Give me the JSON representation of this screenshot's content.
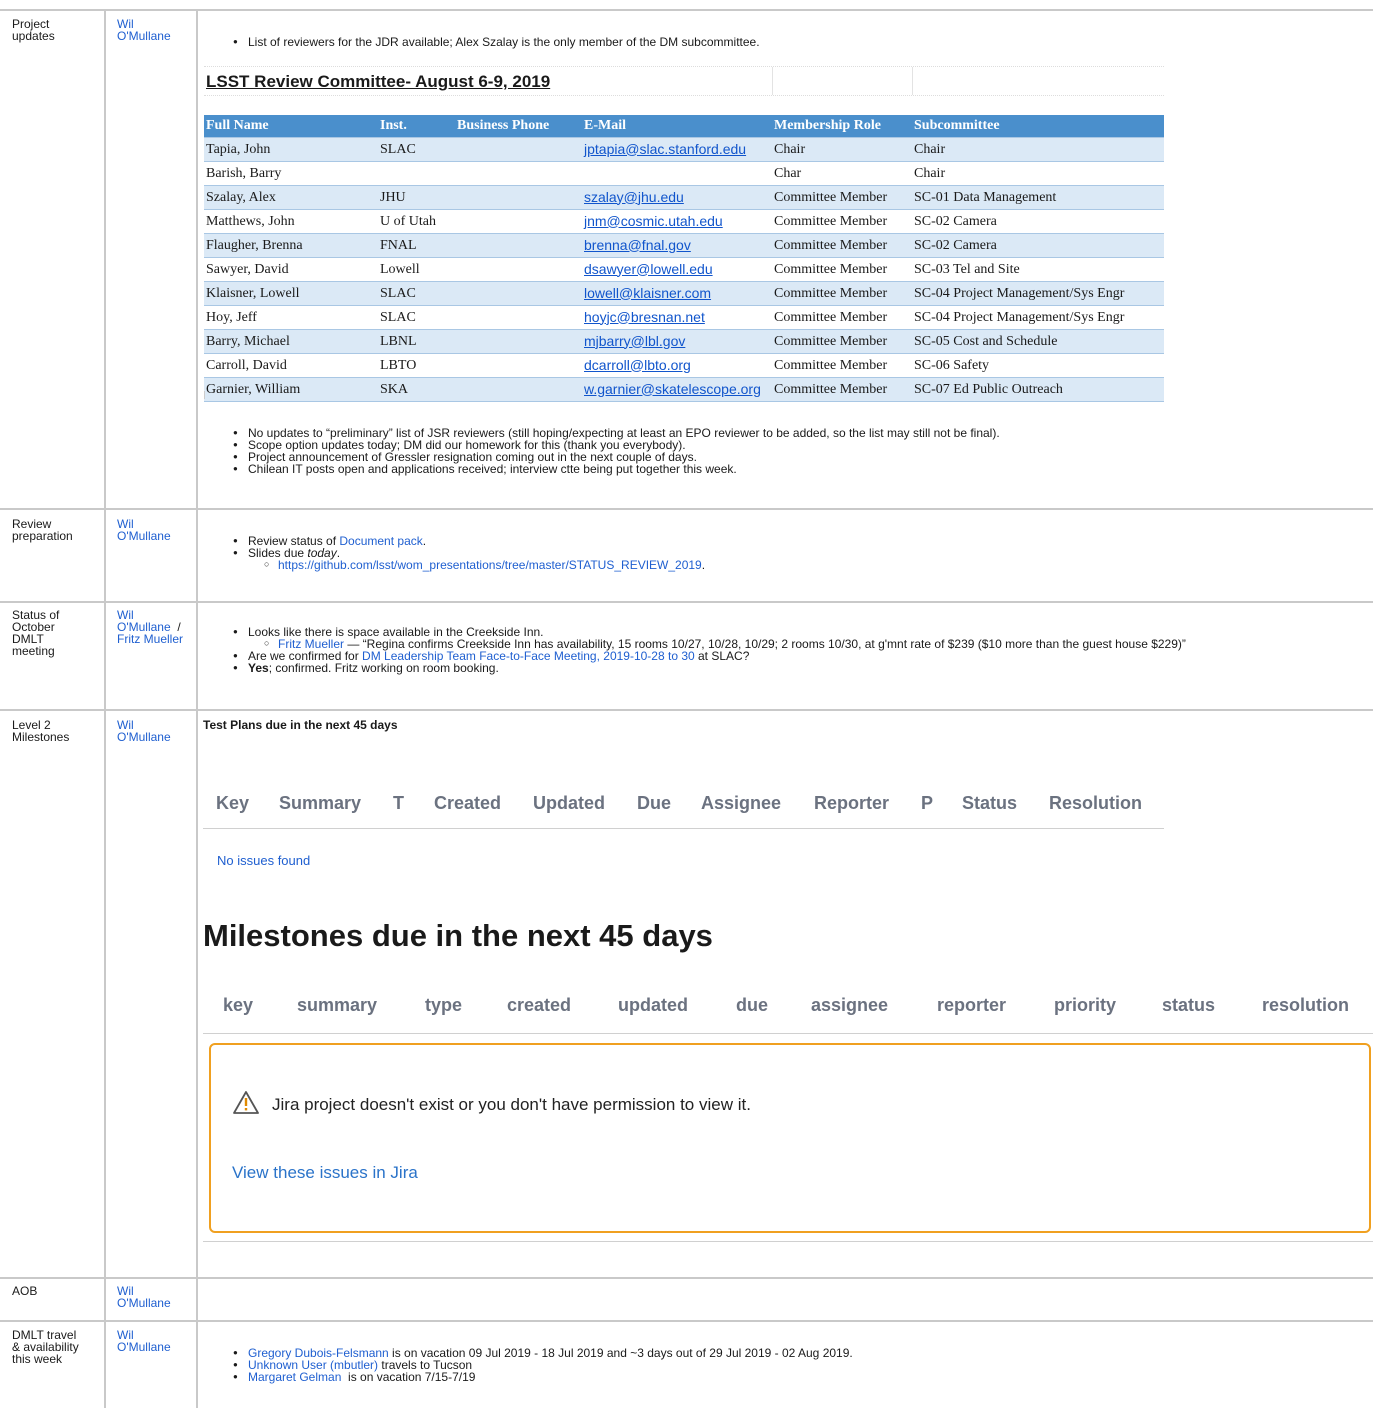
{
  "rows": [
    {
      "topic": [
        "Project",
        "updates"
      ],
      "owner": [
        "Wil",
        "O'Mullane"
      ]
    },
    {
      "topic": [
        "Review",
        "preparation"
      ],
      "owner": [
        "Wil",
        "O'Mullane"
      ]
    },
    {
      "topic": [
        "Status of",
        "October",
        "DMLT",
        "meeting"
      ],
      "owner": [
        "Wil",
        "O'Mullane",
        "/",
        "Fritz Mueller"
      ]
    },
    {
      "topic": [
        "Level 2",
        "Milestones"
      ],
      "owner": [
        "Wil",
        "O'Mullane"
      ]
    },
    {
      "topic": [
        "AOB"
      ],
      "owner": [
        "Wil",
        "O'Mullane"
      ]
    },
    {
      "topic": [
        "DMLT travel",
        "& availability",
        "this week"
      ],
      "owner": [
        "Wil",
        "O'Mullane"
      ]
    }
  ],
  "project": {
    "bullet1": "List of reviewers for the JDR available; Alex Szalay is the only member of the DM subcommittee.",
    "committee_title": "LSST Review Committee- August 6-9, 2019",
    "headers": [
      "Full Name",
      "Inst.",
      "Business Phone",
      "E-Mail",
      "Membership Role",
      "Subcommittee"
    ],
    "members": [
      [
        "Tapia, John",
        "SLAC",
        "",
        "jptapia@slac.stanford.edu",
        "Chair",
        "Chair"
      ],
      [
        "Barish, Barry",
        "",
        "",
        "",
        "Char",
        "Chair"
      ],
      [
        "Szalay, Alex",
        "JHU",
        "",
        "szalay@jhu.edu",
        "Committee Member",
        "SC-01 Data Management"
      ],
      [
        "Matthews, John",
        "U of Utah",
        "",
        "jnm@cosmic.utah.edu",
        "Committee Member",
        "SC-02 Camera"
      ],
      [
        "Flaugher, Brenna",
        "FNAL",
        "",
        "brenna@fnal.gov",
        "Committee Member",
        "SC-02 Camera"
      ],
      [
        "Sawyer, David",
        "Lowell",
        "",
        "dsawyer@lowell.edu",
        "Committee Member",
        "SC-03 Tel and Site"
      ],
      [
        "Klaisner, Lowell",
        "SLAC",
        "",
        "lowell@klaisner.com",
        "Committee Member",
        "SC-04 Project Management/Sys Engr"
      ],
      [
        "Hoy, Jeff",
        "SLAC",
        "",
        "hoyjc@bresnan.net",
        "Committee Member",
        "SC-04 Project Management/Sys Engr"
      ],
      [
        "Barry, Michael",
        "LBNL",
        "",
        "mjbarry@lbl.gov",
        "Committee Member",
        "SC-05 Cost and Schedule"
      ],
      [
        "Carroll, David",
        "LBTO",
        "",
        "dcarroll@lbto.org",
        "Committee Member",
        "SC-06 Safety"
      ],
      [
        "Garnier, William",
        "SKA",
        "",
        "w.garnier@skatelescope.org",
        "Committee Member",
        "SC-07 Ed Public Outreach"
      ]
    ],
    "bullets": [
      "No updates to “preliminary” list of JSR reviewers (still hoping/expecting at least an EPO reviewer to be added, so the list may still not be final).",
      "Scope option updates today; DM did our homework for this (thank you everybody).",
      "Project announcement of Gressler resignation coming out in the next couple of days.",
      "Chilean IT posts open and applications received; interview ctte being put together this week."
    ]
  },
  "review": {
    "b1_pre": "Review status of ",
    "b1_link": "Document pack",
    "b1_post": ".",
    "b2_pre": "Slides due ",
    "b2_em": "today",
    "b2_post": ".",
    "sub_link": "https://github.com/lsst/wom_presentations/tree/master/STATUS_REVIEW_2019",
    "sub_post": "."
  },
  "october": {
    "b1": "Looks like there is space available in the Creekside Inn.",
    "sub_link": "Fritz Mueller",
    "sub_text": " — “Regina confirms Creekside Inn has availability, 15 rooms 10/27, 10/28, 10/29; 2 rooms 10/30, at g'mnt rate of $239 ($10 more than the guest house $229)”",
    "b2_pre": "Are we confirmed for ",
    "b2_link": "DM Leadership Team Face-to-Face Meeting, 2019-10-28 to 30",
    "b2_post": " at SLAC?",
    "b3_bold": "Yes",
    "b3_rest": "; confirmed. Fritz working on room booking."
  },
  "milestones": {
    "test_title": "Test Plans due in the next 45 days",
    "test_cols": [
      "Key",
      "Summary",
      "T",
      "Created",
      "Updated",
      "Due",
      "Assignee",
      "Reporter",
      "P",
      "Status",
      "Resolution"
    ],
    "no_issues": "No issues found",
    "ms_title": "Milestones due in the next 45 days",
    "ms_cols": [
      "key",
      "summary",
      "type",
      "created",
      "updated",
      "due",
      "assignee",
      "reporter",
      "priority",
      "status",
      "resolution"
    ],
    "warning": "Jira project doesn't exist or you don't have permission to view it.",
    "view_link": "View these issues in Jira",
    "warn_color": "#f0a020"
  },
  "travel": {
    "l1_link": "Gregory Dubois-Felsmann",
    "l1_rest": " is on vacation 09 Jul 2019 - 18 Jul 2019 and ~3 days out of 29 Jul 2019 - 02 Aug 2019.",
    "l2_link": "Unknown User (mbutler)",
    "l2_rest": " travels to Tucson",
    "l3_link": "Margaret Gelman",
    "l3_rest": "  is on vacation 7/15-7/19"
  }
}
